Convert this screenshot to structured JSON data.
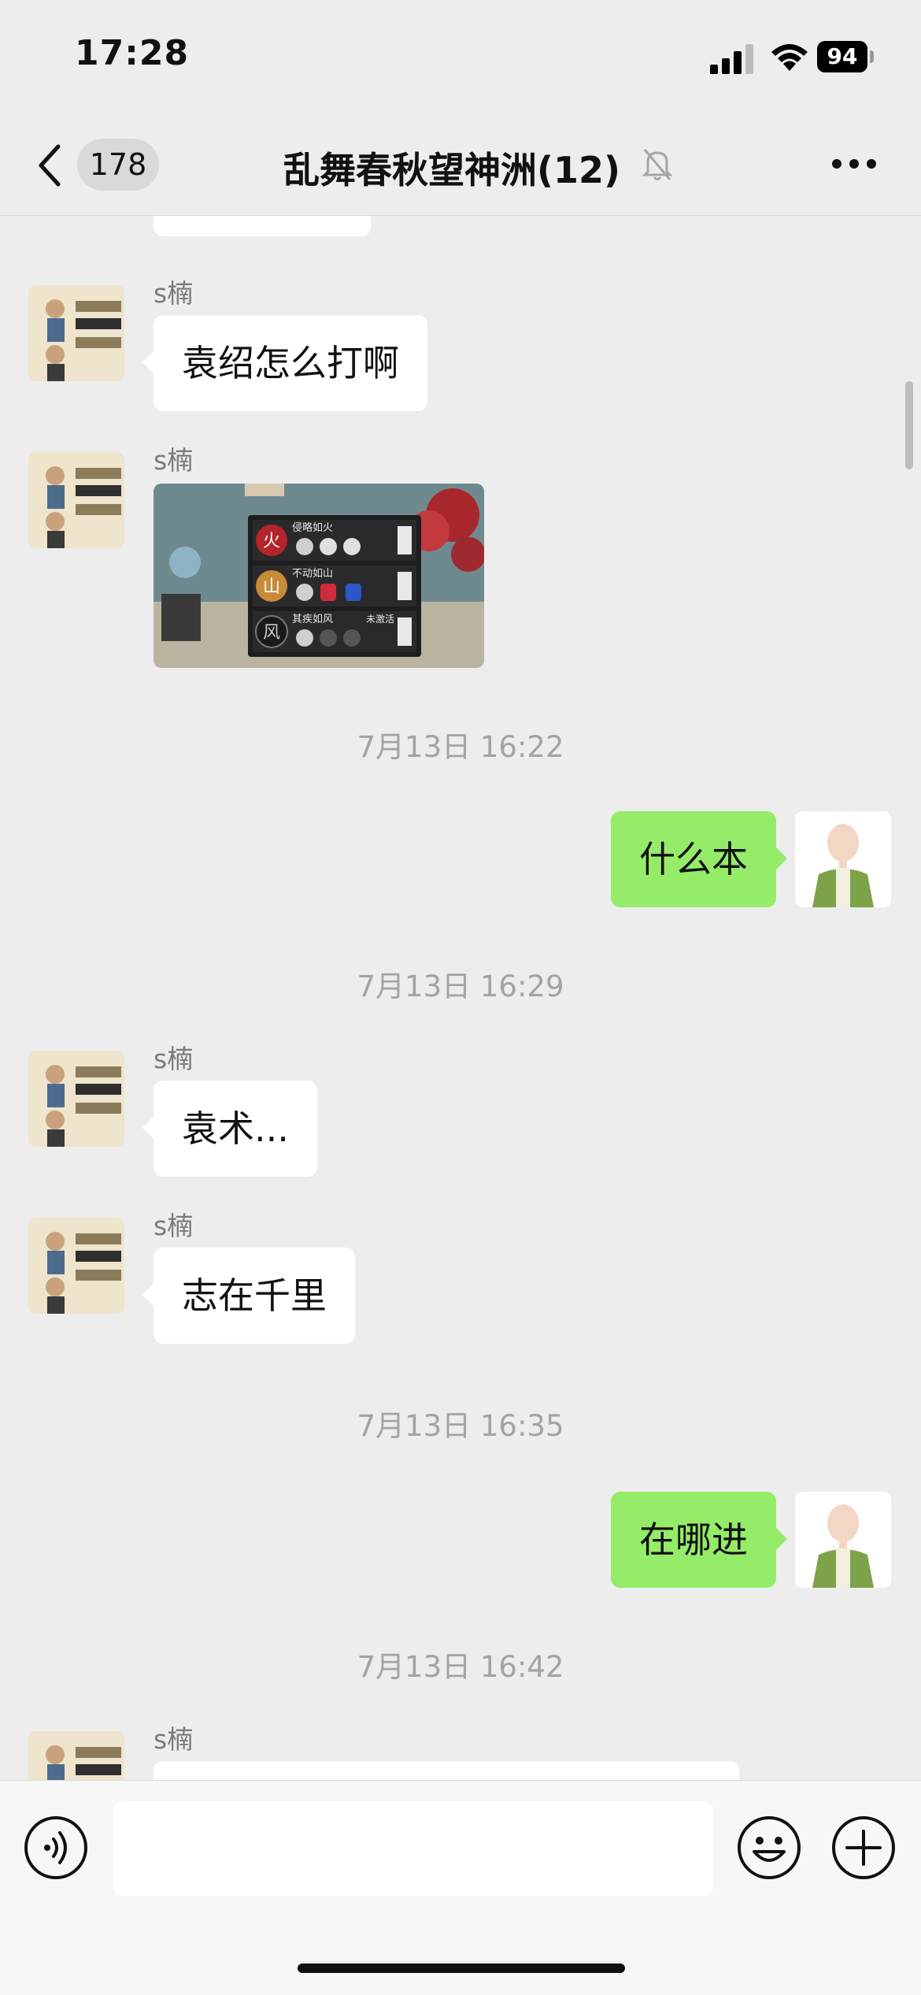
{
  "status_bar": {
    "time": "17:28",
    "battery": "94"
  },
  "nav": {
    "unread_count": "178",
    "title": "乱舞春秋望神洲(12)"
  },
  "messages": [
    {
      "sender": "s楠",
      "text": "袁绍怎么打啊"
    },
    {
      "sender": "s楠",
      "image_labels": [
        "侵略如火",
        "不动如山",
        "其疾如风",
        "未激活",
        "火",
        "山",
        "风"
      ]
    },
    {
      "timestamp": "7月13日 16:22"
    },
    {
      "self_text": "什么本"
    },
    {
      "timestamp": "7月13日 16:29"
    },
    {
      "sender": "s楠",
      "text": "袁术..."
    },
    {
      "sender": "s楠",
      "text": "志在千里"
    },
    {
      "timestamp": "7月13日 16:35"
    },
    {
      "self_text": "在哪进"
    },
    {
      "timestamp": "7月13日 16:42"
    },
    {
      "sender": "s楠"
    }
  ],
  "input": {
    "placeholder": ""
  },
  "colors": {
    "background": "#ededed",
    "self_bubble": "#95ec69",
    "other_bubble": "#ffffff"
  },
  "icons": [
    "back-chevron-icon",
    "muted-bell-icon",
    "more-icon",
    "voice-icon",
    "emoji-icon",
    "plus-icon",
    "signal-icon",
    "wifi-icon",
    "battery-icon"
  ]
}
